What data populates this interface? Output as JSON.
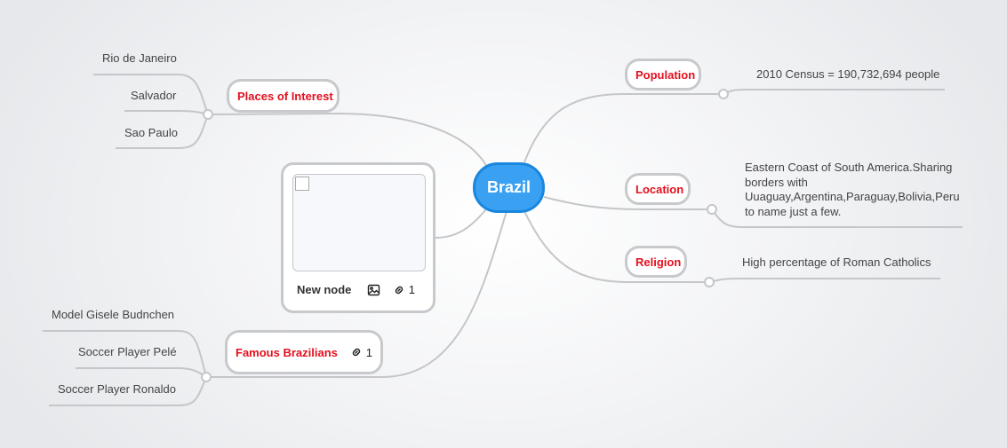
{
  "root": {
    "label": "Brazil"
  },
  "nodes": {
    "places_of_interest": {
      "label": "Places of Interest",
      "children": [
        "Rio de Janeiro",
        "Salvador",
        "Sao Paulo"
      ]
    },
    "famous_brazilians": {
      "label": "Famous Brazilians",
      "link_count": "1",
      "children": [
        "Model Gisele Budnchen",
        "Soccer Player Pelé",
        "Soccer Player Ronaldo"
      ]
    },
    "population": {
      "label": "Population",
      "children": [
        "2010 Census = 190,732,694 people"
      ]
    },
    "location": {
      "label": "Location",
      "children": [
        "Eastern Coast of South America.Sharing borders with Uuaguay,Argentina,Paraguay,Bolivia,Peru to name just a few."
      ]
    },
    "religion": {
      "label": "Religion",
      "children": [
        "High percentage of Roman Catholics"
      ]
    }
  },
  "image_node": {
    "label": "New node",
    "link_count": "1"
  },
  "colors": {
    "root_fill": "#3aa0f2",
    "root_border": "#1a87de",
    "topic_text": "#e3101e",
    "connector": "#c4c6c9"
  },
  "icons": [
    "image-icon",
    "link-icon"
  ]
}
